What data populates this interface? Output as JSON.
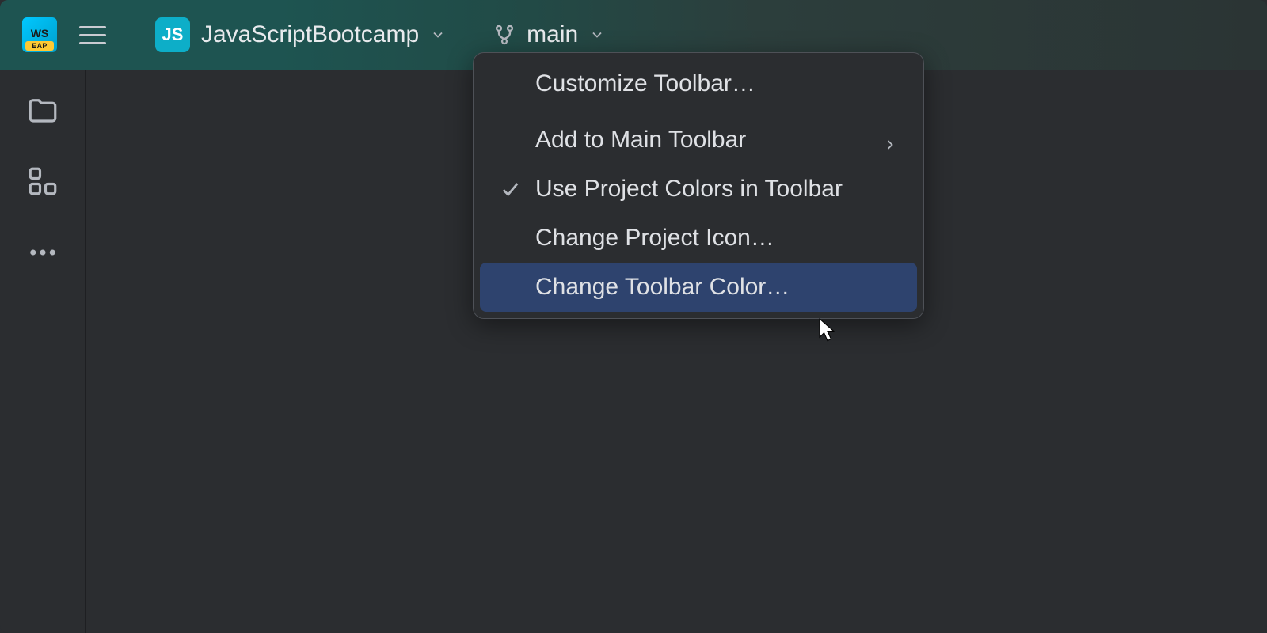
{
  "app": {
    "icon_label_top": "WS",
    "icon_label_bottom": "EAP"
  },
  "toolbar": {
    "project_badge": "JS",
    "project_name": "JavaScriptBootcamp",
    "branch_name": "main"
  },
  "context_menu": {
    "items": [
      {
        "label": "Customize Toolbar…",
        "has_check": false,
        "has_submenu": false,
        "highlighted": false,
        "divider_after": true
      },
      {
        "label": "Add to Main Toolbar",
        "has_check": false,
        "has_submenu": true,
        "highlighted": false,
        "divider_after": false
      },
      {
        "label": "Use Project Colors in Toolbar",
        "has_check": true,
        "has_submenu": false,
        "highlighted": false,
        "divider_after": false
      },
      {
        "label": "Change Project Icon…",
        "has_check": false,
        "has_submenu": false,
        "highlighted": false,
        "divider_after": false
      },
      {
        "label": "Change Toolbar Color…",
        "has_check": false,
        "has_submenu": false,
        "highlighted": true,
        "divider_after": false
      }
    ]
  }
}
